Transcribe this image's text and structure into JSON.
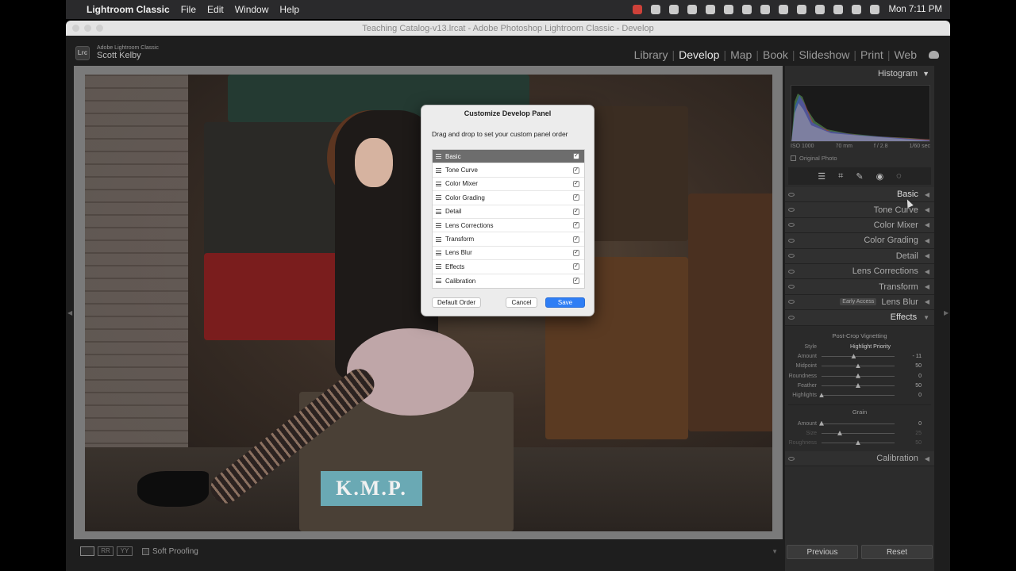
{
  "menubar": {
    "app_name": "Lightroom Classic",
    "items": [
      "File",
      "Edit",
      "Window",
      "Help"
    ],
    "clock": "Mon 7:11 PM"
  },
  "window": {
    "title": "Teaching Catalog-v13.lrcat - Adobe Photoshop Lightroom Classic - Develop"
  },
  "identity": {
    "product": "Adobe Lightroom Classic",
    "user": "Scott Kelby",
    "logo": "Lrc"
  },
  "modules": {
    "items": [
      "Library",
      "Develop",
      "Map",
      "Book",
      "Slideshow",
      "Print",
      "Web"
    ],
    "active": "Develop"
  },
  "photo": {
    "label_text": "K.M.P."
  },
  "toolbar": {
    "soft_proofing": "Soft Proofing"
  },
  "histogram": {
    "header": "Histogram",
    "iso": "ISO 1000",
    "focal": "70 mm",
    "aperture": "f / 2.8",
    "shutter": "1/60 sec",
    "original_photo": "Original Photo"
  },
  "panels": {
    "basic": "Basic",
    "tone_curve": "Tone Curve",
    "color_mixer": "Color Mixer",
    "color_grading": "Color Grading",
    "detail": "Detail",
    "lens_corrections": "Lens Corrections",
    "transform": "Transform",
    "lens_blur": "Lens Blur",
    "early_access": "Early Access",
    "effects": "Effects",
    "calibration": "Calibration"
  },
  "effects": {
    "vignette_header": "Post-Crop Vignetting",
    "style_label": "Style",
    "style_value": "Highlight Priority",
    "sliders": [
      {
        "label": "Amount",
        "value": "- 11",
        "pos": 0.44
      },
      {
        "label": "Midpoint",
        "value": "50",
        "pos": 0.5
      },
      {
        "label": "Roundness",
        "value": "0",
        "pos": 0.5
      },
      {
        "label": "Feather",
        "value": "50",
        "pos": 0.5
      },
      {
        "label": "Highlights",
        "value": "0",
        "pos": 0.0
      }
    ],
    "grain_header": "Grain",
    "grain": [
      {
        "label": "Amount",
        "value": "0",
        "pos": 0.0
      },
      {
        "label": "Size",
        "value": "25",
        "pos": 0.25
      },
      {
        "label": "Roughness",
        "value": "50",
        "pos": 0.5
      }
    ]
  },
  "buttons": {
    "previous": "Previous",
    "reset": "Reset"
  },
  "dialog": {
    "title": "Customize Develop Panel",
    "message": "Drag and drop to set your custom panel order",
    "items": [
      {
        "label": "Basic",
        "checked": true
      },
      {
        "label": "Tone Curve",
        "checked": true
      },
      {
        "label": "Color Mixer",
        "checked": true
      },
      {
        "label": "Color Grading",
        "checked": true
      },
      {
        "label": "Detail",
        "checked": true
      },
      {
        "label": "Lens Corrections",
        "checked": true
      },
      {
        "label": "Transform",
        "checked": true
      },
      {
        "label": "Lens Blur",
        "checked": true
      },
      {
        "label": "Effects",
        "checked": true
      },
      {
        "label": "Calibration",
        "checked": true
      }
    ],
    "default_order": "Default Order",
    "cancel": "Cancel",
    "save": "Save"
  }
}
